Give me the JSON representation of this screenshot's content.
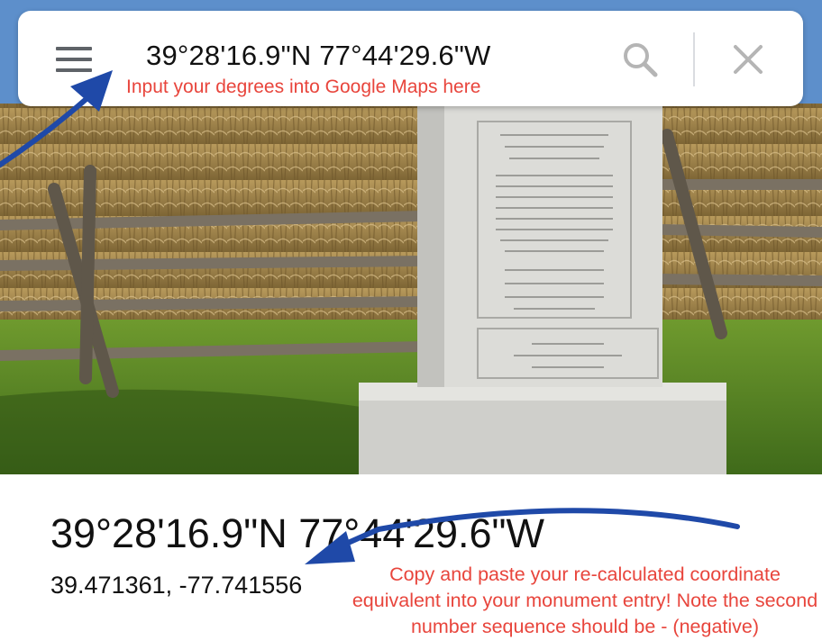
{
  "search": {
    "query": "39°28'16.9\"N 77°44'29.6\"W",
    "hint": "Input your degrees into Google Maps here"
  },
  "icons": {
    "menu": "hamburger-menu-icon",
    "search": "magnifier-icon",
    "close": "x-close-icon"
  },
  "place_panel": {
    "dms": "39°28'16.9\"N 77°44'29.6\"W",
    "decimal": "39.471361, -77.741556"
  },
  "annotations": {
    "copy_hint": "Copy and paste your re-calculated coordinate equivalent into your monument entry! Note the second number sequence should be - (negative)"
  },
  "colors": {
    "annotation_text": "#e8453c",
    "annotation_arrow": "#1f49a8",
    "icon_gray": "#5f6368"
  }
}
